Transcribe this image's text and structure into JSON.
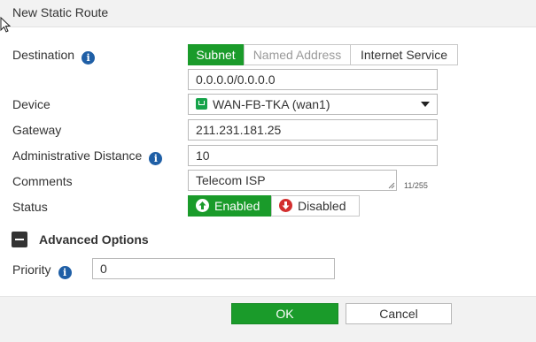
{
  "dialog": {
    "title": "New Static Route"
  },
  "fields": {
    "destination": {
      "label": "Destination",
      "tabs": [
        "Subnet",
        "Named Address",
        "Internet Service"
      ],
      "value": "0.0.0.0/0.0.0.0"
    },
    "device": {
      "label": "Device",
      "value": "WAN-FB-TKA (wan1)"
    },
    "gateway": {
      "label": "Gateway",
      "value": "211.231.181.25"
    },
    "admin_distance": {
      "label": "Administrative Distance",
      "value": "10"
    },
    "comments": {
      "label": "Comments",
      "value": "Telecom ISP",
      "counter": "11/255"
    },
    "status": {
      "label": "Status",
      "enabled_label": "Enabled",
      "disabled_label": "Disabled"
    }
  },
  "advanced": {
    "label": "Advanced Options",
    "priority": {
      "label": "Priority",
      "value": "0"
    }
  },
  "footer": {
    "ok_label": "OK",
    "cancel_label": "Cancel"
  }
}
